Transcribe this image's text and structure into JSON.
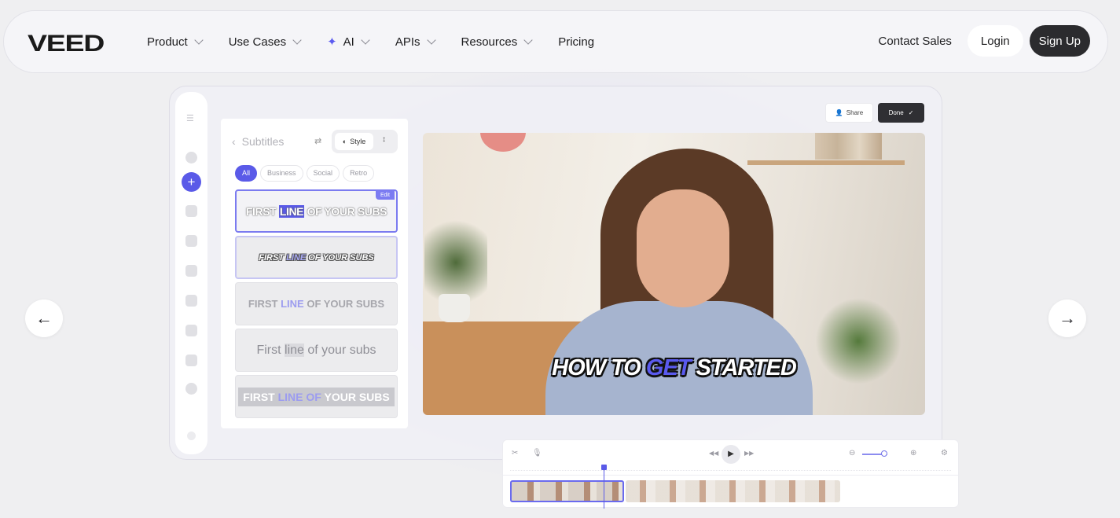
{
  "nav": {
    "logo": "VEED",
    "items": [
      {
        "label": "Product",
        "has_dropdown": true
      },
      {
        "label": "Use Cases",
        "has_dropdown": true
      },
      {
        "label": "AI",
        "has_dropdown": true,
        "icon": "sparkle-icon"
      },
      {
        "label": "APIs",
        "has_dropdown": true
      },
      {
        "label": "Resources",
        "has_dropdown": true
      },
      {
        "label": "Pricing",
        "has_dropdown": false
      }
    ],
    "contact_sales": "Contact Sales",
    "login": "Login",
    "signup": "Sign Up"
  },
  "editor": {
    "share_label": "Share",
    "done_label": "Done",
    "panel": {
      "title": "Subtitles",
      "style_label": "Style",
      "filters": [
        "All",
        "Business",
        "Social",
        "Retro"
      ],
      "active_filter": "All",
      "edit_tag": "Edit",
      "styles": [
        {
          "before": "FIRST ",
          "word": "LINE",
          "after": " OF YOUR SUBS"
        },
        {
          "before": "FIRST ",
          "word": "LINE",
          "after": " OF YOUR SUBS"
        },
        {
          "before": "FIRST ",
          "word": "LINE",
          "after": " OF YOUR SUBS"
        },
        {
          "before": "First ",
          "word": "line",
          "after": " of your subs"
        },
        {
          "before": "FIRST ",
          "word": "LINE OF",
          "after": " YOUR SUBS"
        }
      ]
    },
    "caption": {
      "before": "HOW TO ",
      "word": "GET",
      "after": " STARTED"
    }
  },
  "colors": {
    "accent": "#5a5ae8",
    "dark": "#2b2b2e"
  }
}
